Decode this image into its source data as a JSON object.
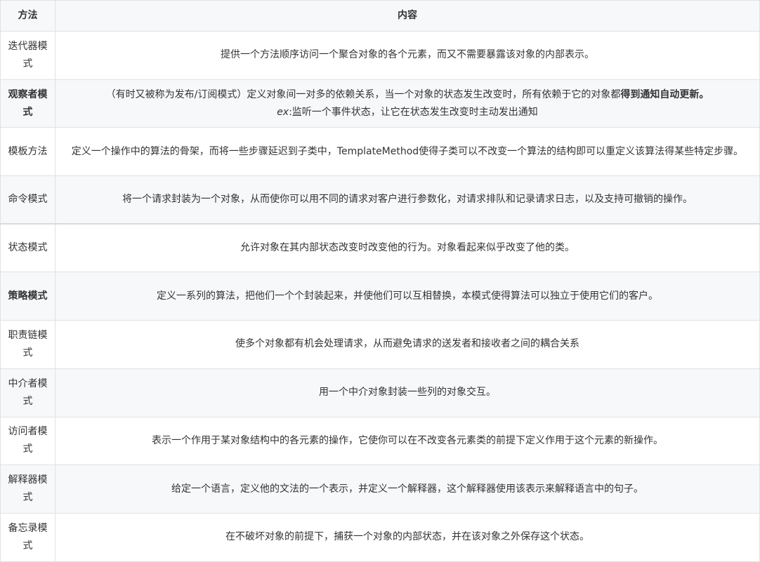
{
  "header": {
    "col_method": "方法",
    "col_content": "内容"
  },
  "rows": [
    {
      "name": "迭代器模式",
      "content": "提供一个方法顺序访问一个聚合对象的各个元素，而又不需要暴露该对象的内部表示。"
    },
    {
      "name": "观察者模式",
      "content_pre": "（有时又被称为发布/订阅模式）定义对象间一对多的依赖关系，当一个对象的状态发生改变时，所有依赖于它的对象都",
      "content_bold": "得到通知自动更新。",
      "content_ex": "ex",
      "content_ex_rest": ":监听一个事件状态，让它在状态发生改变时主动发出通知"
    },
    {
      "name": "模板方法",
      "content": "定义一个操作中的算法的骨架，而将一些步骤延迟到子类中，TemplateMethod使得子类可以不改变一个算法的结构即可以重定义该算法得某些特定步骤。"
    },
    {
      "name": "命令模式",
      "content": "将一个请求封装为一个对象，从而使你可以用不同的请求对客户进行参数化，对请求排队和记录请求日志，以及支持可撤销的操作。"
    },
    {
      "name": "状态模式",
      "content": "允许对象在其内部状态改变时改变他的行为。对象看起来似乎改变了他的类。"
    },
    {
      "name": "策略模式",
      "content": "定义一系列的算法，把他们一个个封装起来，并使他们可以互相替换，本模式使得算法可以独立于使用它们的客户。"
    },
    {
      "name": "职责链模式",
      "content": "使多个对象都有机会处理请求，从而避免请求的送发者和接收者之间的耦合关系"
    },
    {
      "name": "中介者模式",
      "content": "用一个中介对象封装一些列的对象交互。"
    },
    {
      "name": "访问者模式",
      "content": "表示一个作用于某对象结构中的各元素的操作，它使你可以在不改变各元素类的前提下定义作用于这个元素的新操作。"
    },
    {
      "name": "解释器模式",
      "content": "给定一个语言，定义他的文法的一个表示，并定义一个解释器，这个解释器使用该表示来解释语言中的句子。"
    },
    {
      "name": "备忘录模式",
      "content": "在不破坏对象的前提下，捕获一个对象的内部状态，并在该对象之外保存这个状态。"
    }
  ]
}
